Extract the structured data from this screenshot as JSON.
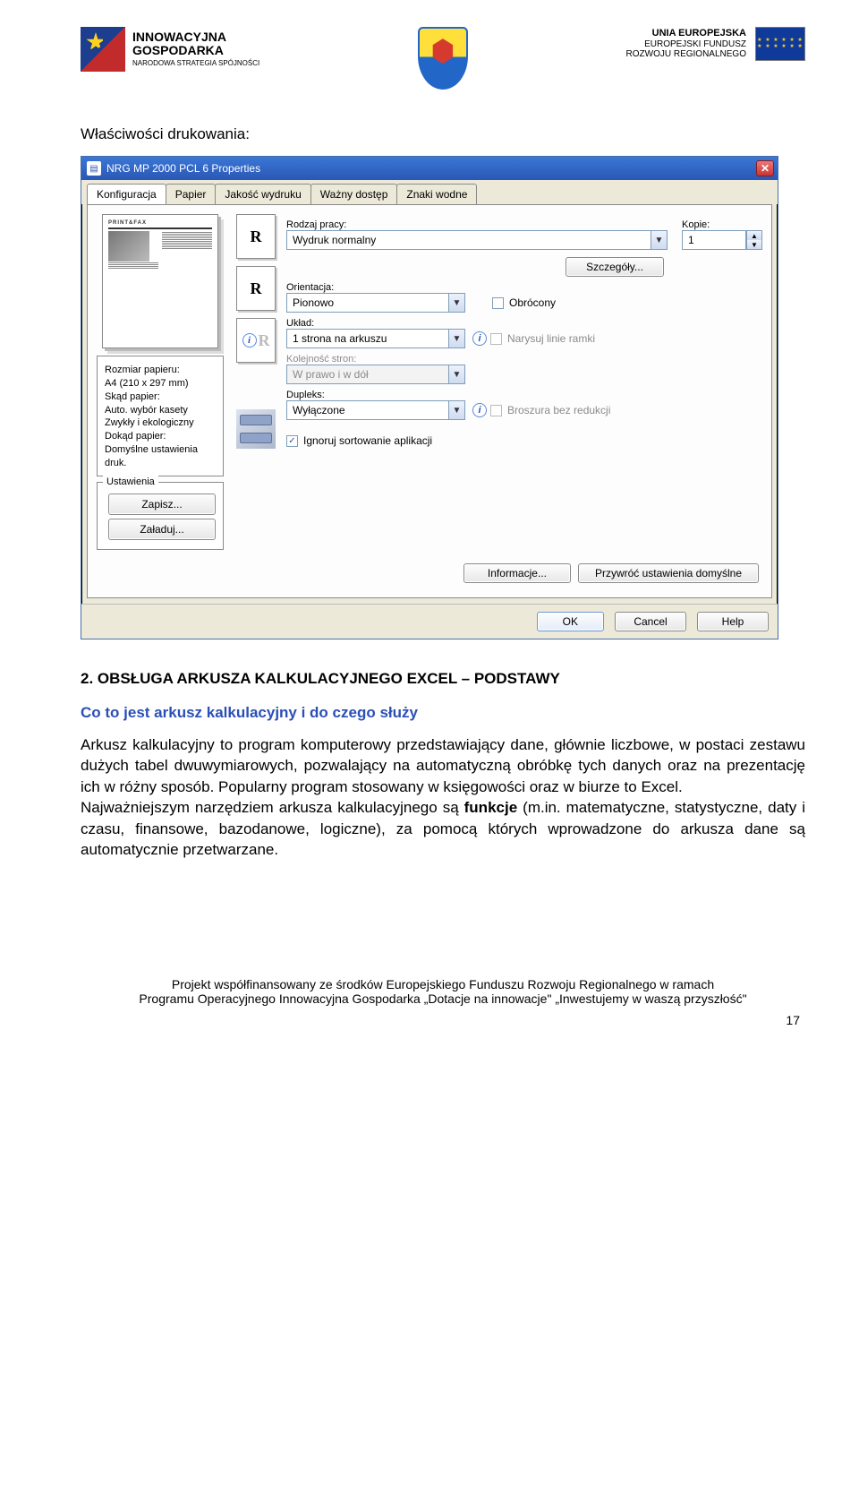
{
  "header": {
    "left_logo": {
      "line1": "INNOWACYJNA",
      "line2": "GOSPODARKA",
      "line3": "NARODOWA STRATEGIA SPÓJNOŚCI"
    },
    "right_logo": {
      "line1": "UNIA EUROPEJSKA",
      "line2": "EUROPEJSKI FUNDUSZ",
      "line3": "ROZWOJU REGIONALNEGO"
    }
  },
  "section_label": "Właściwości drukowania:",
  "dialog": {
    "title": "NRG MP 2000 PCL 6 Properties",
    "tabs": [
      "Konfiguracja",
      "Papier",
      "Jakość wydruku",
      "Ważny dostęp",
      "Znaki wodne"
    ],
    "active_tab": 0,
    "left_panel": {
      "group_label_box": "",
      "paper_info": {
        "l1": "Rozmiar papieru:",
        "l2": "A4 (210 x 297 mm)",
        "l3": "Skąd papier:",
        "l4": "Auto. wybór kasety",
        "l5": "Zwykły i ekologiczny",
        "l6": "Dokąd papier:",
        "l7": "Domyślne ustawienia druk."
      },
      "settings_legend": "Ustawienia",
      "save_btn": "Zapisz...",
      "load_btn": "Załaduj..."
    },
    "thumbs": {
      "r1": "R",
      "r2": "R",
      "r3": "R"
    },
    "fields": {
      "job_label": "Rodzaj pracy:",
      "job_value": "Wydruk normalny",
      "copies_label": "Kopie:",
      "copies_value": "1",
      "details_btn": "Szczegóły...",
      "orient_label": "Orientacja:",
      "orient_value": "Pionowo",
      "rotated_label": "Obrócony",
      "layout_label": "Układ:",
      "layout_value": "1 strona na arkuszu",
      "frame_label": "Narysuj linie ramki",
      "pageorder_label": "Kolejność stron:",
      "pageorder_value": "W prawo i w dół",
      "duplex_label": "Dupleks:",
      "duplex_value": "Wyłączone",
      "booklet_label": "Broszura bez redukcji",
      "ignore_sort_label": "Ignoruj sortowanie aplikacji",
      "info_btn": "Informacje...",
      "restore_btn": "Przywróć ustawienia domyślne"
    },
    "buttons": {
      "ok": "OK",
      "cancel": "Cancel",
      "help": "Help"
    }
  },
  "heading_numbered": "2. OBSŁUGA ARKUSZA KALKULACYJNEGO EXCEL – PODSTAWY",
  "subheading": "Co to jest arkusz kalkulacyjny i do czego służy",
  "paragraph_1": "Arkusz kalkulacyjny to program komputerowy przedstawiający dane, głównie liczbowe, w postaci zestawu dużych tabel dwuwymiarowych, pozwalający na automatyczną obróbkę tych danych oraz na prezentację ich w różny sposób. Popularny program stosowany w księgowości oraz w biurze to Excel.",
  "paragraph_2a": "Najważniejszym narzędziem arkusza kalkulacyjnego są ",
  "paragraph_2b": "funkcje",
  "paragraph_2c": " (m.in. matematyczne, statystyczne, daty i czasu, finansowe, bazodanowe, logiczne), za pomocą których wprowadzone do arkusza dane są automatycznie przetwarzane.",
  "footer": {
    "l1": "Projekt współfinansowany ze środków Europejskiego Funduszu Rozwoju Regionalnego w ramach",
    "l2": "Programu Operacyjnego Innowacyjna Gospodarka „Dotacje na innowacje\" „Inwestujemy w waszą przyszłość\"",
    "page": "17"
  }
}
